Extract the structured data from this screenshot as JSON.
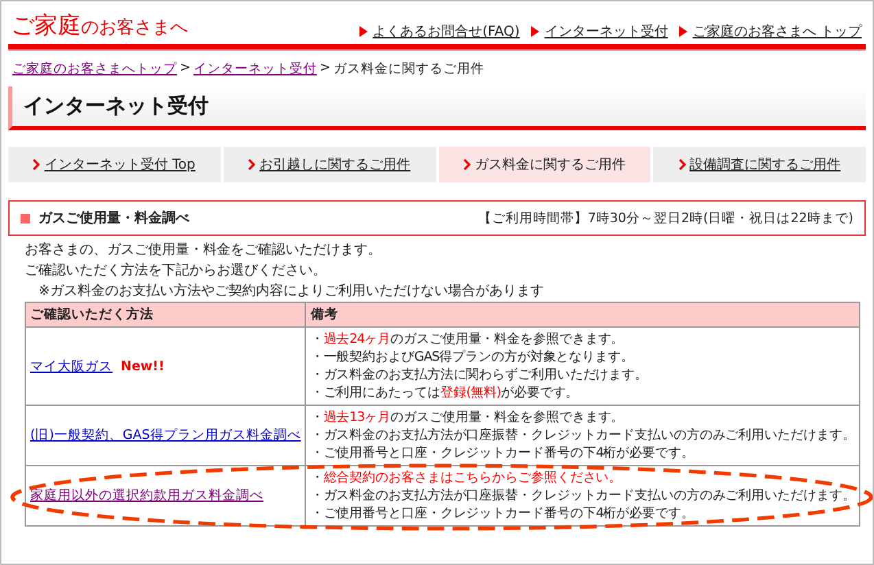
{
  "header": {
    "logo_main": "ご家庭",
    "logo_sub": "のお客さまへ",
    "links": [
      "よくあるお問合せ(FAQ)",
      "インターネット受付",
      "ご家庭のお客さまへ トップ"
    ]
  },
  "breadcrumb": {
    "links": [
      "ご家庭のお客さまへトップ",
      "インターネット受付"
    ],
    "separator": ">",
    "current": "ガス料金に関するご用件"
  },
  "page_title": "インターネット受付",
  "tabs": [
    {
      "label": "インターネット受付 Top",
      "selected": false
    },
    {
      "label": "お引越しに関するご用件",
      "selected": false
    },
    {
      "label": "ガス料金に関するご用件",
      "selected": true
    },
    {
      "label": "設備調査に関するご用件",
      "selected": false
    }
  ],
  "section": {
    "title": "ガスご使用量・料金調べ",
    "hours": "【ご利用時間帯】7時30分～翌日2時(日曜・祝日は22時まで)"
  },
  "intro": [
    "お客さまの、ガスご使用量・料金をご確認いただけます。",
    "ご確認いただく方法を下記からお選びください。"
  ],
  "notice": "※ガス料金のお支払い方法やご契約内容によりご利用いただけない場合があります",
  "table": {
    "columns": [
      "ご確認いただく方法",
      "備考"
    ],
    "rows": [
      {
        "method": "マイ大阪ガス",
        "visited": false,
        "badge": "New!!",
        "highlighted": false,
        "notes": [
          [
            {
              "text": "・"
            },
            {
              "text": "過去24ヶ月",
              "red": true
            },
            {
              "text": "のガスご使用量・料金を参照できます。"
            }
          ],
          [
            {
              "text": "・一般契約およびGAS得プランの方が対象となります。"
            }
          ],
          [
            {
              "text": "・ガス料金のお支払方法に関わらずご利用いただけます。"
            }
          ],
          [
            {
              "text": "・ご利用にあたっては"
            },
            {
              "text": "登録(無料)",
              "red": true
            },
            {
              "text": "が必要です。"
            }
          ]
        ]
      },
      {
        "method": "(旧)一般契約、GAS得プラン用ガス料金調べ",
        "visited": false,
        "highlighted": false,
        "notes": [
          [
            {
              "text": "・"
            },
            {
              "text": "過去13ヶ月",
              "red": true
            },
            {
              "text": "のガスご使用量・料金を参照できます。"
            }
          ],
          [
            {
              "text": "・ガス料金のお支払方法が口座振替・クレジットカード支払いの方のみご利用いただけます。"
            }
          ],
          [
            {
              "text": "・ご使用番号と口座・クレジットカード番号の下4桁が必要です。"
            }
          ]
        ]
      },
      {
        "method": "家庭用以外の選択約款用ガス料金調べ",
        "visited": true,
        "highlighted": true,
        "notes": [
          [
            {
              "text": "・"
            },
            {
              "text": "総合契約のお客さまはこちらからご参照ください。",
              "red": true
            }
          ],
          [
            {
              "text": "・ガス料金のお支払方法が口座振替・クレジットカード支払いの方のみご利用いただけます。"
            }
          ],
          [
            {
              "text": "・ご使用番号と口座・クレジットカード番号の下4桁が必要です。"
            }
          ]
        ]
      }
    ]
  }
}
